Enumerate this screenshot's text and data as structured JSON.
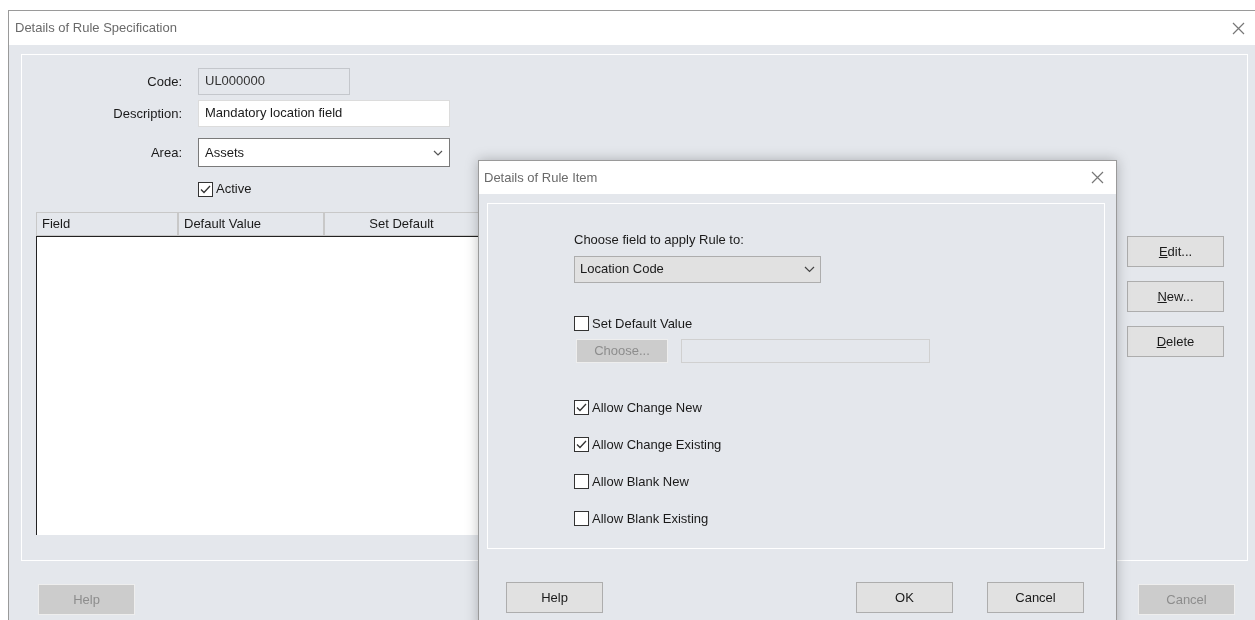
{
  "dialog": {
    "title": "Details of Rule Specification",
    "fields": [
      {
        "kind": "text",
        "label": "Code:",
        "value": "UL000000",
        "disabled": true
      },
      {
        "kind": "text",
        "label": "Description:",
        "value": "Mandatory location field",
        "disabled": false
      },
      {
        "kind": "dropdown",
        "label": "Area:",
        "value": "Assets"
      }
    ],
    "active": {
      "label": "Active",
      "checked": true
    },
    "table": {
      "columns": [
        "Field",
        "Default Value",
        "Set Default"
      ]
    },
    "side_buttons": [
      {
        "access_key": "E",
        "rest": "dit..."
      },
      {
        "access_key": "N",
        "rest": "ew..."
      },
      {
        "access_key": "D",
        "rest": "elete"
      }
    ],
    "buttons": [
      {
        "label": "Help",
        "disabled": true
      },
      {
        "label": "Cancel",
        "disabled": true
      }
    ]
  },
  "modal": {
    "title": "Details of Rule Item",
    "prompt": "Choose field to apply Rule to:",
    "field": {
      "value": "Location Code"
    },
    "set_default": {
      "label": "Set Default Value",
      "checked": false
    },
    "choose_button": {
      "label": "Choose...",
      "disabled": true
    },
    "options": [
      {
        "label": "Allow Change New",
        "checked": true
      },
      {
        "label": "Allow Change Existing",
        "checked": true
      },
      {
        "label": "Allow Blank New",
        "checked": false
      },
      {
        "label": "Allow Blank Existing",
        "checked": false
      }
    ],
    "buttons": [
      {
        "label": "Help",
        "disabled": false
      },
      {
        "label": "OK",
        "disabled": false
      },
      {
        "label": "Cancel",
        "disabled": false
      }
    ]
  }
}
